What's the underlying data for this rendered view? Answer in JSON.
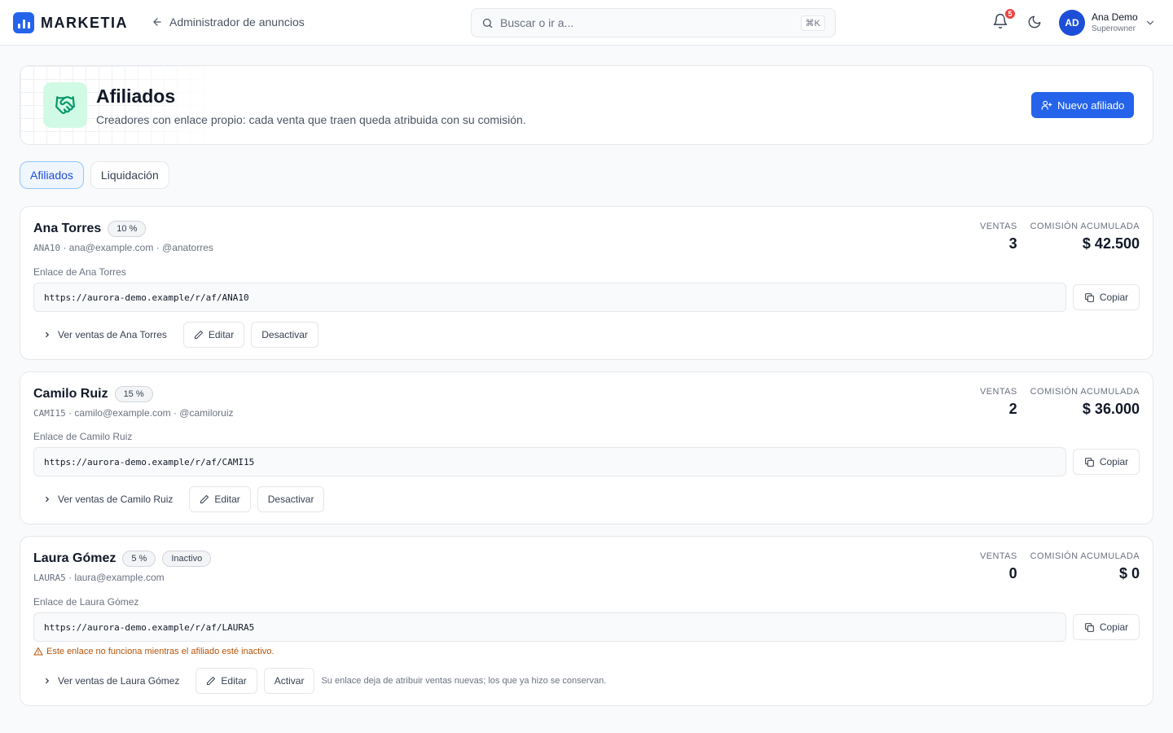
{
  "header": {
    "brand": "MARKETIA",
    "back_label": "Administrador de anuncios",
    "search_placeholder": "Buscar o ir a...",
    "search_shortcut": "⌘K",
    "notifications_count": "5",
    "user": {
      "initials": "AD",
      "name": "Ana Demo",
      "role": "Superowner"
    }
  },
  "page": {
    "title": "Afiliados",
    "subtitle": "Creadores con enlace propio: cada venta que traen queda atribuida con su comisión.",
    "new_button": "Nuevo afiliado"
  },
  "tabs": [
    {
      "label": "Afiliados",
      "active": true
    },
    {
      "label": "Liquidación",
      "active": false
    }
  ],
  "labels": {
    "sales": "VENTAS",
    "commission": "COMISIÓN ACUMULADA",
    "copy": "Copiar",
    "edit": "Editar"
  },
  "affiliates": [
    {
      "name": "Ana Torres",
      "rate": "10 %",
      "code": "ANA10",
      "meta": " · ana@example.com · @anatorres",
      "sales": "3",
      "commission": "$ 42.500",
      "link_label": "Enlace de Ana Torres",
      "link": "https://aurora-demo.example/r/af/ANA10",
      "view_sales": "Ver ventas de Ana Torres",
      "toggle": "Desactivar"
    },
    {
      "name": "Camilo Ruiz",
      "rate": "15 %",
      "code": "CAMI15",
      "meta": " · camilo@example.com · @camiloruiz",
      "sales": "2",
      "commission": "$ 36.000",
      "link_label": "Enlace de Camilo Ruiz",
      "link": "https://aurora-demo.example/r/af/CAMI15",
      "view_sales": "Ver ventas de Camilo Ruiz",
      "toggle": "Desactivar"
    },
    {
      "name": "Laura Gómez",
      "rate": "5 %",
      "status": "Inactivo",
      "code": "LAURA5",
      "meta": " · laura@example.com",
      "sales": "0",
      "commission": "$ 0",
      "link_label": "Enlace de Laura Gómez",
      "link": "https://aurora-demo.example/r/af/LAURA5",
      "warning": "Este enlace no funciona mientras el afiliado esté inactivo.",
      "view_sales": "Ver ventas de Laura Gómez",
      "toggle": "Activar",
      "toggle_hint": "Su enlace deja de atribuir ventas nuevas; los que ya hizo se conservan."
    }
  ]
}
